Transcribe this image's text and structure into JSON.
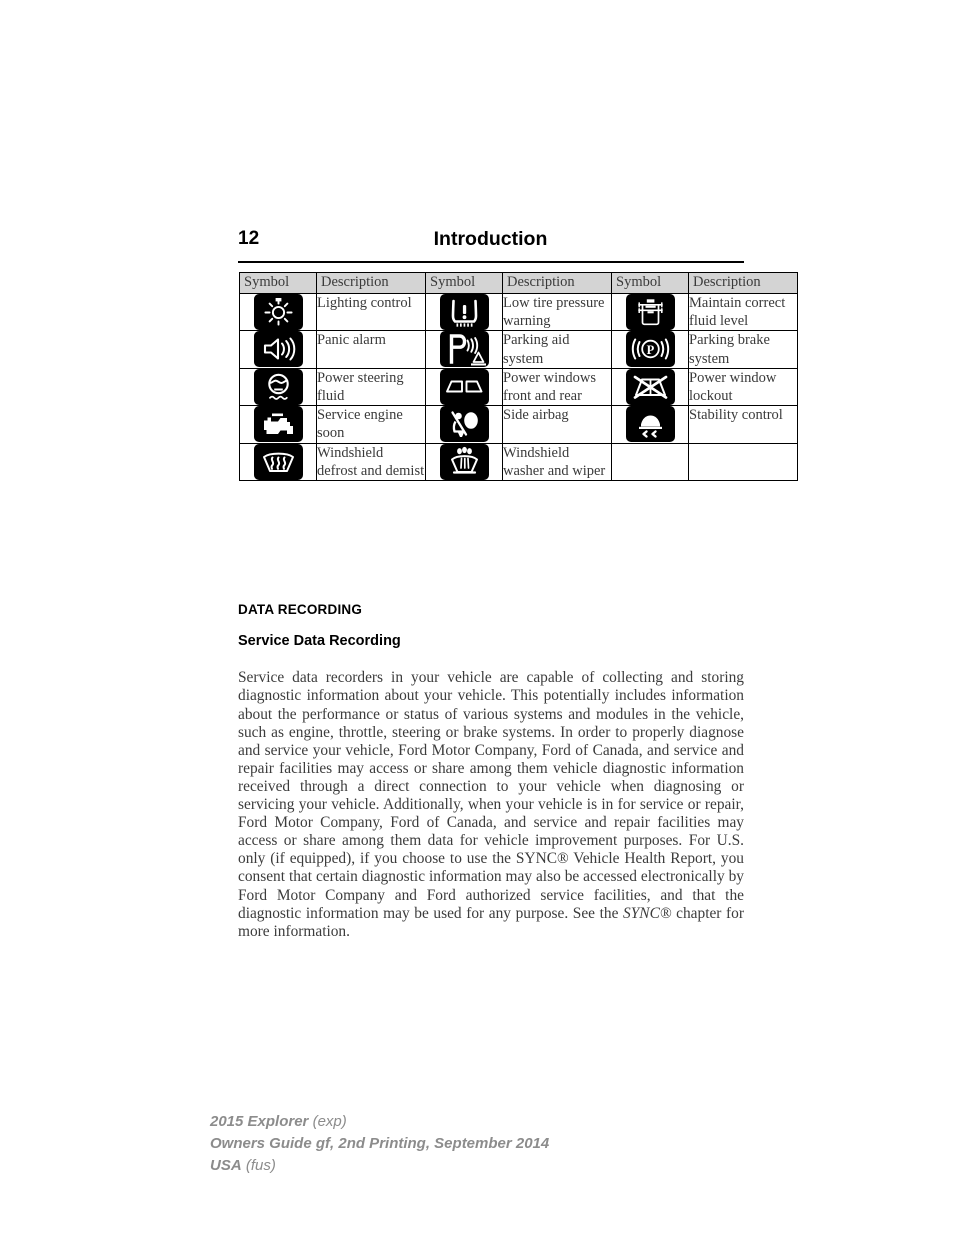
{
  "header": {
    "page_number": "12",
    "title": "Introduction"
  },
  "table": {
    "headers": [
      "Symbol",
      "Description",
      "Symbol",
      "Description",
      "Symbol",
      "Description"
    ],
    "rows": [
      [
        {
          "icon": "lighting-control-icon",
          "desc": "Lighting control"
        },
        {
          "icon": "low-tire-pressure-warning-icon",
          "desc": "Low tire pressure warning"
        },
        {
          "icon": "maintain-correct-fluid-level-icon",
          "desc": "Maintain correct fluid level"
        }
      ],
      [
        {
          "icon": "panic-alarm-icon",
          "desc": "Panic alarm"
        },
        {
          "icon": "parking-aid-system-icon",
          "desc": "Parking aid system"
        },
        {
          "icon": "parking-brake-system-icon",
          "desc": "Parking brake system"
        }
      ],
      [
        {
          "icon": "power-steering-fluid-icon",
          "desc": "Power steering fluid"
        },
        {
          "icon": "power-windows-front-and-rear-icon",
          "desc": "Power windows front and rear"
        },
        {
          "icon": "power-window-lockout-icon",
          "desc": "Power window lockout"
        }
      ],
      [
        {
          "icon": "service-engine-soon-icon",
          "desc": "Service engine soon"
        },
        {
          "icon": "side-airbag-icon",
          "desc": "Side airbag"
        },
        {
          "icon": "stability-control-icon",
          "desc": "Stability control"
        }
      ],
      [
        {
          "icon": "windshield-defrost-and-demist-icon",
          "desc": "Windshield defrost and demist"
        },
        {
          "icon": "windshield-washer-and-wiper-icon",
          "desc": "Windshield washer and wiper"
        },
        {
          "icon": "",
          "desc": ""
        }
      ]
    ]
  },
  "content": {
    "section_heading": "DATA RECORDING",
    "sub_heading": "Service Data Recording",
    "paragraph_part1": "Service data recorders in your vehicle are capable of collecting and storing diagnostic information about your vehicle. This potentially includes information about the performance or status of various systems and modules in the vehicle, such as engine, throttle, steering or brake systems. In order to properly diagnose and service your vehicle, Ford Motor Company, Ford of Canada, and service and repair facilities may access or share among them vehicle diagnostic information received through a direct connection to your vehicle when diagnosing or servicing your vehicle. Additionally, when your vehicle is in for service or repair, Ford Motor Company, Ford of Canada, and service and repair facilities may access or share among them data for vehicle improvement purposes. For U.S. only (if equipped), if you choose to use the SYNC® Vehicle Health Report, you consent that certain diagnostic information may also be accessed electronically by Ford Motor Company and Ford authorized service facilities, and that the diagnostic information may be used for any purpose. See the ",
    "paragraph_italic": "SYNC®",
    "paragraph_part2": " chapter for more information."
  },
  "footer": {
    "line1_strong": "2015 Explorer",
    "line1_light": "(exp)",
    "line2_strong": "Owners Guide gf, 2nd Printing, September 2014",
    "line3_strong": "USA",
    "line3_light": "(fus)"
  },
  "colors": {
    "header_fill": "#d4d4d4",
    "text": "#3a3a3a",
    "icon_tile": "#000000",
    "footer_text": "#8c8c8c"
  }
}
